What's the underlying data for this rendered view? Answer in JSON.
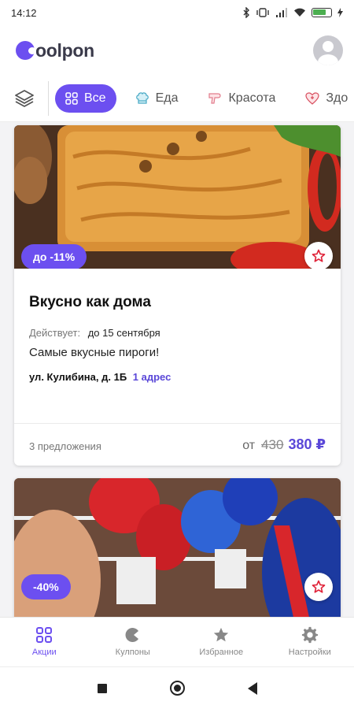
{
  "status_bar": {
    "time": "14:12",
    "icons": [
      "bluetooth-icon",
      "vibrate-icon",
      "signal-icon",
      "wifi-icon",
      "battery-icon",
      "charging-icon"
    ]
  },
  "header": {
    "logo_text": "oolpon",
    "avatar_icon": "user-avatar-icon"
  },
  "categories": {
    "layers_icon": "layers-icon",
    "items": [
      {
        "label": "Все",
        "icon": "grid-icon",
        "active": true
      },
      {
        "label": "Еда",
        "icon": "chef-hat-icon",
        "active": false
      },
      {
        "label": "Красота",
        "icon": "hair-dryer-icon",
        "active": false
      },
      {
        "label": "Здо",
        "icon": "heart-health-icon",
        "active": false
      }
    ]
  },
  "deals": [
    {
      "discount": "до -11%",
      "title": "Вкусно как дома",
      "valid_label": "Действует:",
      "valid_value": "до 15 сентября",
      "description": "Самые вкусные пироги!",
      "address": "ул. Кулибина, д. 1Б",
      "address_link": "1 адрес",
      "offers_count": "3 предложения",
      "price_from": "от",
      "price_old": "430",
      "price_new": "380 ₽",
      "image_icon": "pie-photo"
    },
    {
      "discount": "-40%",
      "image_icon": "boxing-photo"
    }
  ],
  "bottom_nav": [
    {
      "label": "Акции",
      "icon": "grid-icon",
      "active": true
    },
    {
      "label": "Кулпоны",
      "icon": "coupon-pacman-icon",
      "active": false
    },
    {
      "label": "Избранное",
      "icon": "star-icon",
      "active": false
    },
    {
      "label": "Настройки",
      "icon": "gear-icon",
      "active": false
    }
  ],
  "colors": {
    "accent": "#6c4ff0",
    "price": "#5a47d8",
    "fav_star": "#e0243a"
  }
}
